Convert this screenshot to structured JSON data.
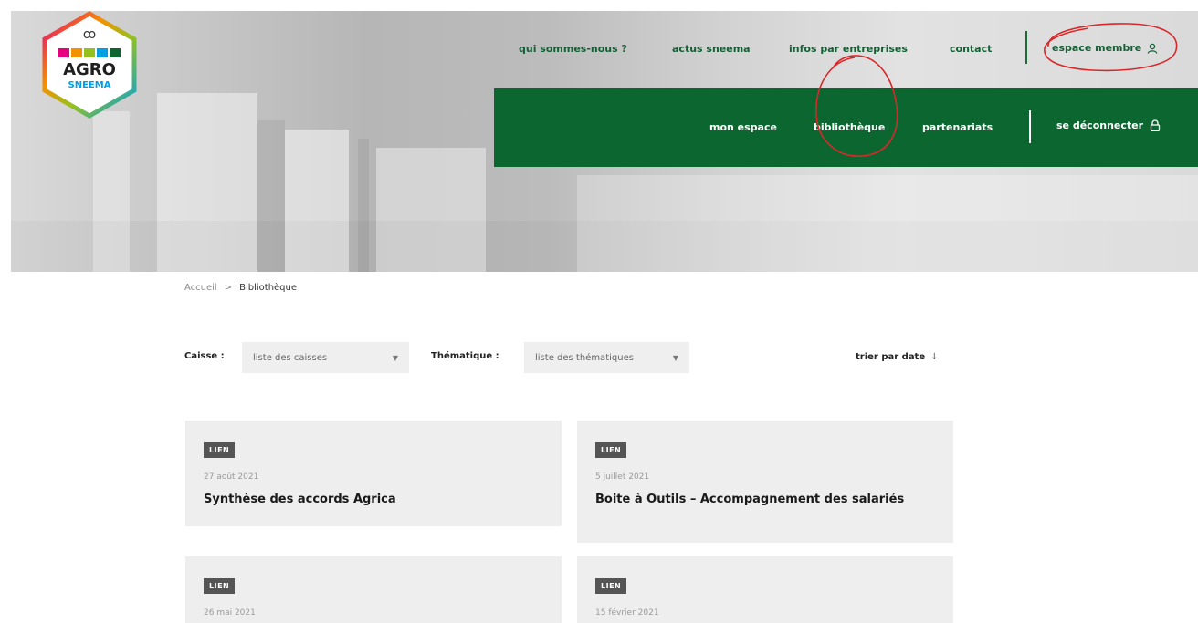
{
  "logo": {
    "alt": "AGRO SNEEMA",
    "line1": "AGRO",
    "line2": "SNEEMA"
  },
  "topnav": {
    "items": [
      {
        "label": "qui sommes-nous ?"
      },
      {
        "label": "actus sneema"
      },
      {
        "label": "infos par entreprises"
      },
      {
        "label": "contact"
      }
    ],
    "member": {
      "label": "espace membre",
      "icon": "user-icon"
    }
  },
  "greenbar": {
    "items": [
      {
        "label": "mon espace"
      },
      {
        "label": "bibliothèque"
      },
      {
        "label": "partenariats"
      }
    ],
    "logout": {
      "label": "se déconnecter",
      "icon": "lock-icon"
    }
  },
  "breadcrumb": {
    "home": "Accueil",
    "separator": ">",
    "current": "Bibliothèque"
  },
  "filters": {
    "caisse": {
      "label": "Caisse :",
      "value": "liste des caisses"
    },
    "thematique": {
      "label": "Thématique :",
      "value": "liste des thématiques"
    },
    "sort": {
      "label": "trier par date",
      "icon": "arrow-down-icon"
    }
  },
  "cards": [
    {
      "badge": "LIEN",
      "date": "27 août 2021",
      "title": "Synthèse des accords Agrica"
    },
    {
      "badge": "LIEN",
      "date": "5 juillet 2021",
      "title": "Boite à Outils – Accompagnement des salariés"
    },
    {
      "badge": "LIEN",
      "date": "26 mai 2021",
      "title": ""
    },
    {
      "badge": "LIEN",
      "date": "15 février 2021",
      "title": ""
    }
  ],
  "colors": {
    "brand_green": "#0c6630",
    "text_green": "#155f35",
    "annotation_red": "#d9282a"
  }
}
